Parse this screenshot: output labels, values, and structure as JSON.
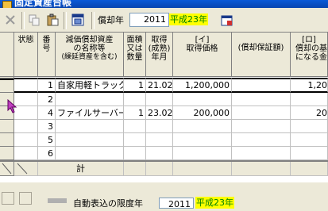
{
  "window": {
    "title": "固定資産台帳"
  },
  "toolbar": {
    "year_label": "償却年",
    "year_value": "2011",
    "era_label": "平成23年"
  },
  "grid": {
    "headers": {
      "status": "状態",
      "number": [
        "番",
        "号"
      ],
      "name": [
        "減価償却資産",
        "の名称等",
        "(繰延資産を含む)"
      ],
      "area": [
        "面積",
        "又は",
        "数量"
      ],
      "acquired": [
        "取得",
        "(成熟)",
        "年月"
      ],
      "cost": [
        "[イ]",
        "取得価格"
      ],
      "guarantee": "(償却保証額)",
      "ro": [
        "[ロ]",
        "償却の基",
        "になる金"
      ]
    },
    "rows": [
      {
        "no": "1",
        "name": "自家用軽トラック",
        "qty": "1",
        "date": "21.02",
        "cost": "1,200,000",
        "ro": "1,20"
      },
      {
        "no": "2",
        "name": "",
        "qty": "",
        "date": "",
        "cost": "",
        "ro": ""
      },
      {
        "no": "4",
        "name": "ファイルサーバー",
        "qty": "1",
        "date": "23.02",
        "cost": "200,000",
        "ro": "20"
      },
      {
        "no": "3",
        "name": "",
        "qty": "",
        "date": "",
        "cost": "",
        "ro": ""
      },
      {
        "no": "5",
        "name": "",
        "qty": "",
        "date": "",
        "cost": "",
        "ro": ""
      },
      {
        "no": "6",
        "name": "",
        "qty": "",
        "date": "",
        "cost": "",
        "ro": ""
      }
    ],
    "total_label": "計"
  },
  "bottom": {
    "label": "自動表込の限度年",
    "year_value": "2011",
    "era_label": "平成23年"
  }
}
